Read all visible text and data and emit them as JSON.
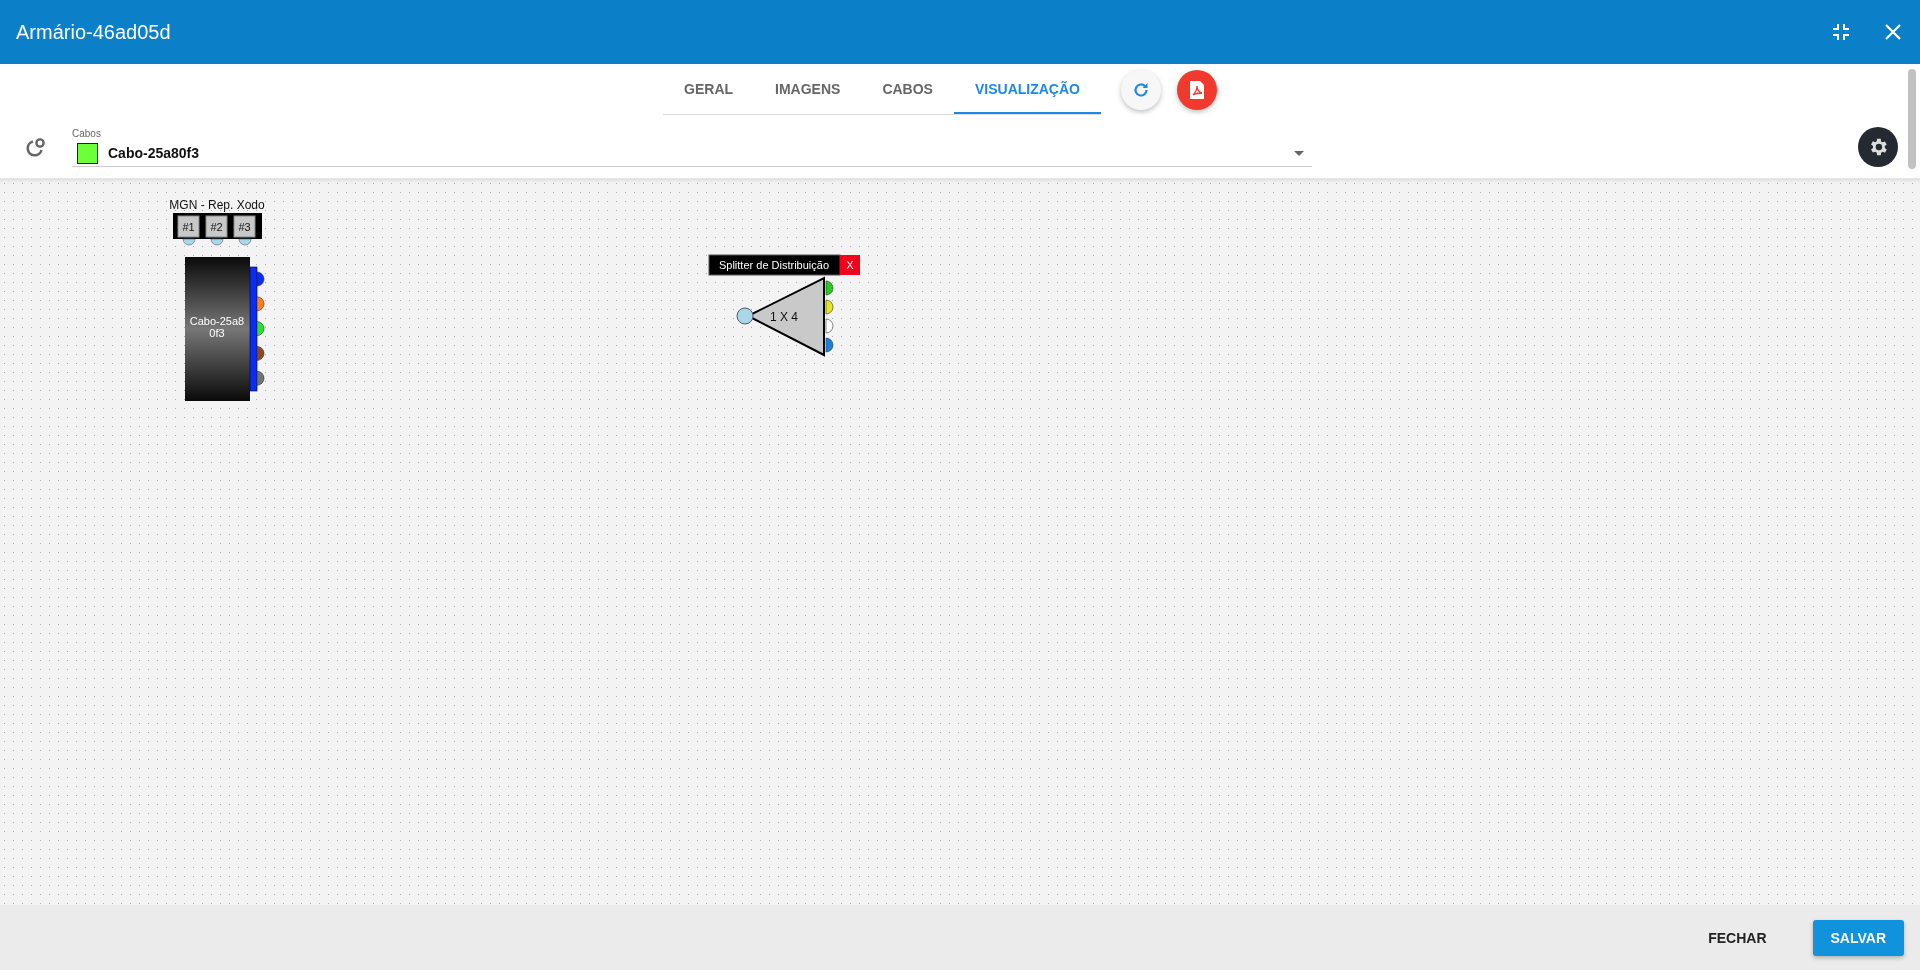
{
  "window": {
    "title": "Armário-46ad05d"
  },
  "tabs": [
    {
      "label": "GERAL",
      "selected": false
    },
    {
      "label": "IMAGENS",
      "selected": false
    },
    {
      "label": "CABOS",
      "selected": false
    },
    {
      "label": "VISUALIZAÇÃO",
      "selected": true
    }
  ],
  "cable_select": {
    "label": "Cabos",
    "value": "Cabo-25a80f3",
    "color": "#6cff3a"
  },
  "diagram": {
    "cable_node": {
      "title": "MGN - Rep. Xodo",
      "tubes": [
        {
          "label": "#1"
        },
        {
          "label": "#2"
        },
        {
          "label": "#3"
        }
      ],
      "name_lines": [
        "Cabo-25a8",
        "0f3"
      ],
      "fibers": [
        {
          "color": "#0a2cf5"
        },
        {
          "color": "#ff7f1e"
        },
        {
          "color": "#2ee02e"
        },
        {
          "color": "#8a4a1e"
        },
        {
          "color": "#6f7670"
        }
      ]
    },
    "splitter": {
      "title": "Splitter de Distribuição",
      "close": "X",
      "ratio": "1 X 4",
      "outputs": [
        {
          "color": "#22cc22"
        },
        {
          "color": "#e6e61e"
        },
        {
          "color": "#ffffff"
        },
        {
          "color": "#1a7fe0"
        }
      ]
    }
  },
  "footer": {
    "buttons": [
      {
        "label": "FECHAR",
        "kind": "text"
      },
      {
        "label": "SALVAR",
        "kind": "primary"
      }
    ]
  }
}
